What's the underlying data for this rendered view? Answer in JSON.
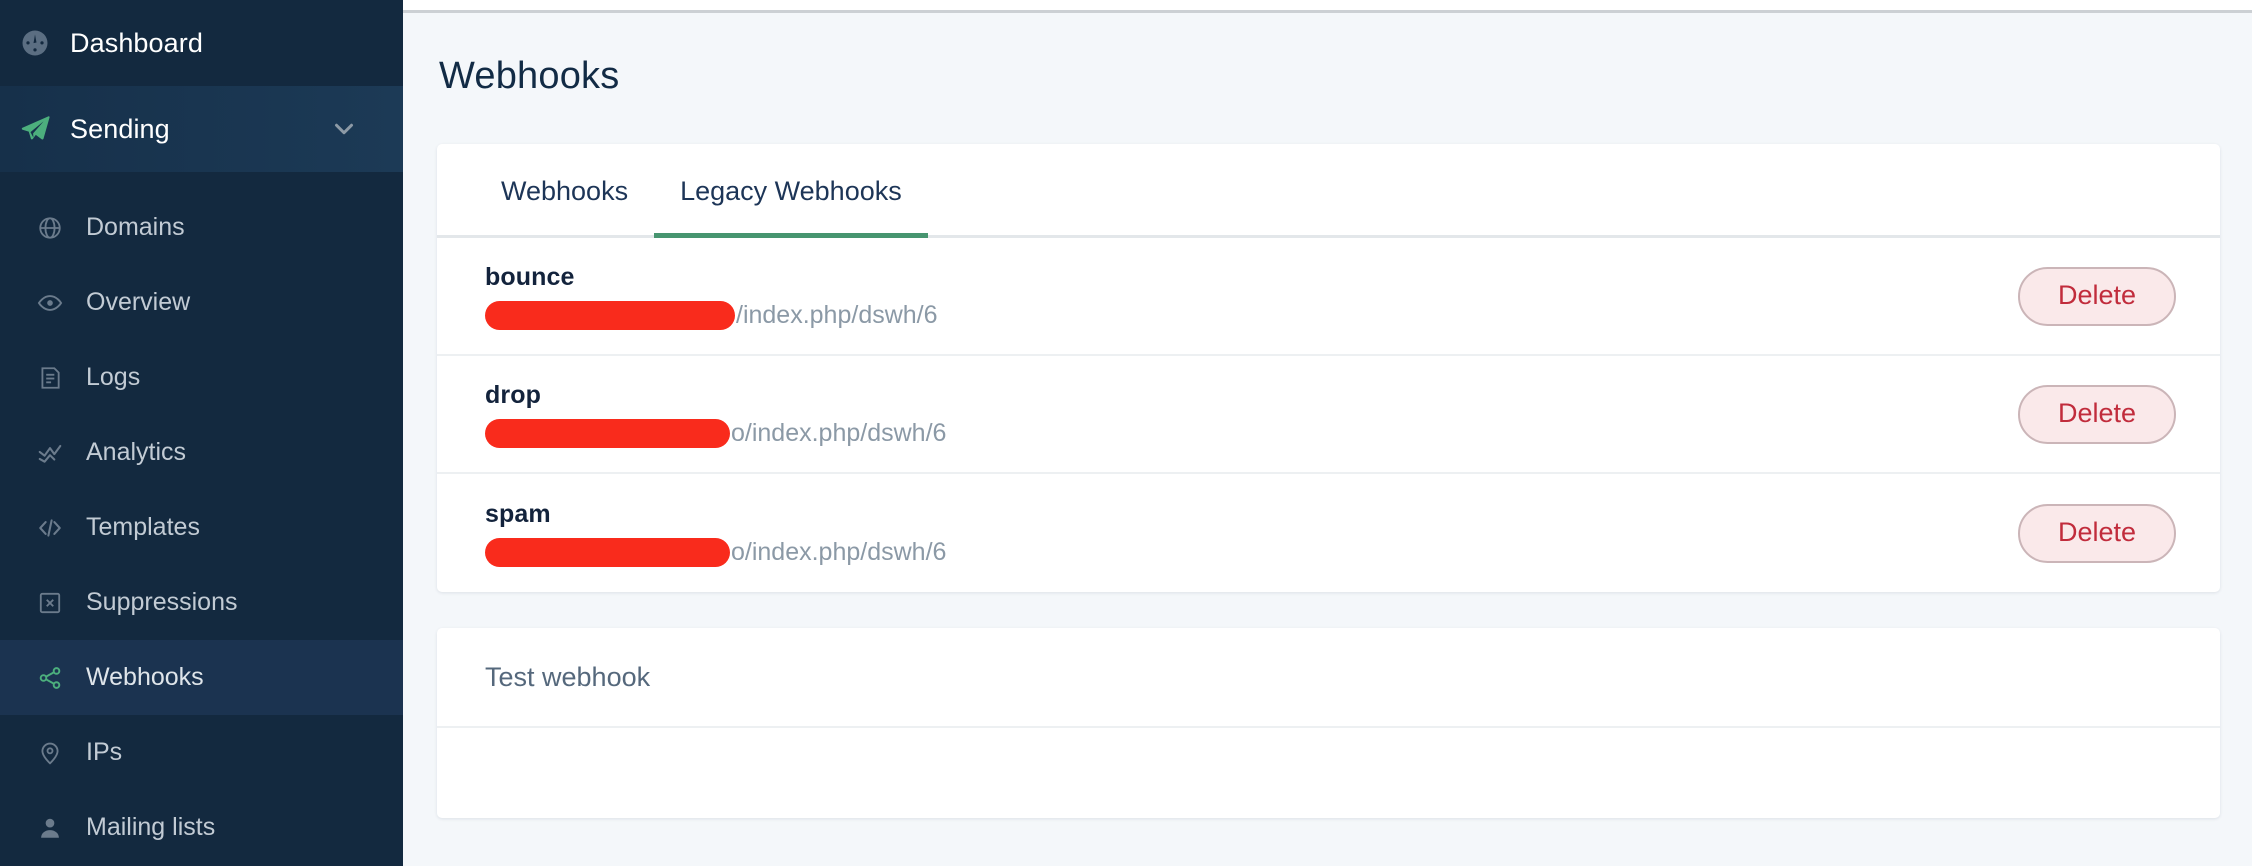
{
  "sidebar": {
    "primary": [
      {
        "label": "Dashboard",
        "icon": "gauge-icon",
        "key": "dashboard",
        "active": false
      },
      {
        "label": "Sending",
        "icon": "paper-plane-icon",
        "key": "sending",
        "active": true,
        "expanded": true,
        "chevron": "chevron-down-icon"
      }
    ],
    "sub_items": [
      {
        "label": "Domains",
        "icon": "globe-icon",
        "key": "domains",
        "active": false
      },
      {
        "label": "Overview",
        "icon": "eye-icon",
        "key": "overview",
        "active": false
      },
      {
        "label": "Logs",
        "icon": "document-icon",
        "key": "logs",
        "active": false
      },
      {
        "label": "Analytics",
        "icon": "analytics-icon",
        "key": "analytics",
        "active": false
      },
      {
        "label": "Templates",
        "icon": "code-icon",
        "key": "templates",
        "active": false
      },
      {
        "label": "Suppressions",
        "icon": "box-x-icon",
        "key": "suppressions",
        "active": false
      },
      {
        "label": "Webhooks",
        "icon": "share-nodes-icon",
        "key": "webhooks",
        "active": true
      },
      {
        "label": "IPs",
        "icon": "map-pin-icon",
        "key": "ips",
        "active": false
      },
      {
        "label": "Mailing lists",
        "icon": "person-icon",
        "key": "mailing-lists",
        "active": false
      }
    ]
  },
  "page": {
    "title": "Webhooks"
  },
  "tabs": [
    {
      "label": "Webhooks",
      "active": false
    },
    {
      "label": "Legacy Webhooks",
      "active": true
    }
  ],
  "webhooks": [
    {
      "name": "bounce",
      "url_visible": "/index.php/dswh/6",
      "redaction_width": 250,
      "delete_label": "Delete"
    },
    {
      "name": "drop",
      "url_visible": "o/index.php/dswh/6",
      "redaction_width": 245,
      "delete_label": "Delete"
    },
    {
      "name": "spam",
      "url_visible": "o/index.php/dswh/6",
      "redaction_width": 245,
      "delete_label": "Delete"
    }
  ],
  "test_section": {
    "title": "Test webhook"
  },
  "colors": {
    "sidebar_bg": "#13293f",
    "sidebar_active_bg": "#1b3350",
    "accent_green": "#479570",
    "redaction_red": "#f92b1c",
    "delete_text": "#c12c3c",
    "delete_bg": "#fae9ea",
    "page_bg": "#f4f7fa",
    "title_color": "#122b45"
  }
}
